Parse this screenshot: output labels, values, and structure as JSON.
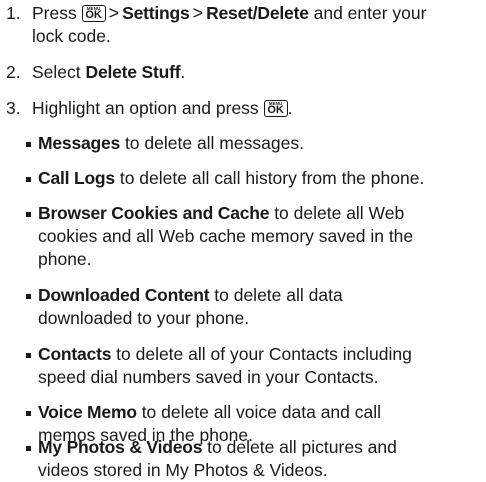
{
  "steps": [
    {
      "number": "1.",
      "pre": "Press",
      "key": {
        "menu": "MENU",
        "ok": "OK"
      },
      "separator": ">",
      "settings": "Settings",
      "reset": "Reset/Delete",
      "post": "and enter your",
      "line2": "lock code."
    },
    {
      "number": "2.",
      "pre": "Select",
      "target": "Delete Stuff",
      "post": "."
    },
    {
      "number": "3.",
      "text": "Highlight an option and press",
      "key": {
        "menu": "MENU",
        "ok": "OK"
      },
      "post": "."
    }
  ],
  "options": [
    {
      "name": "Messages",
      "lines": [
        " to delete all messages."
      ]
    },
    {
      "name": "Call Logs",
      "lines": [
        " to delete all call history from the phone."
      ]
    },
    {
      "name": "Browser Cookies and Cache",
      "lines": [
        " to delete all Web",
        "cookies and all Web cache memory saved in the",
        "phone."
      ]
    },
    {
      "name": "Downloaded Content",
      "lines": [
        " to delete all data",
        "downloaded to your phone."
      ]
    },
    {
      "name": "Contacts",
      "lines": [
        " to delete all of your Contacts including",
        "speed dial numbers saved in your Contacts."
      ]
    },
    {
      "name": "Voice Memo",
      "lines": [
        " to delete all voice data and call",
        "memos saved in the phone."
      ]
    },
    {
      "name": "My Photos & Videos",
      "lines": [
        " to delete all pictures and",
        "videos stored in My Photos & Videos."
      ]
    }
  ]
}
